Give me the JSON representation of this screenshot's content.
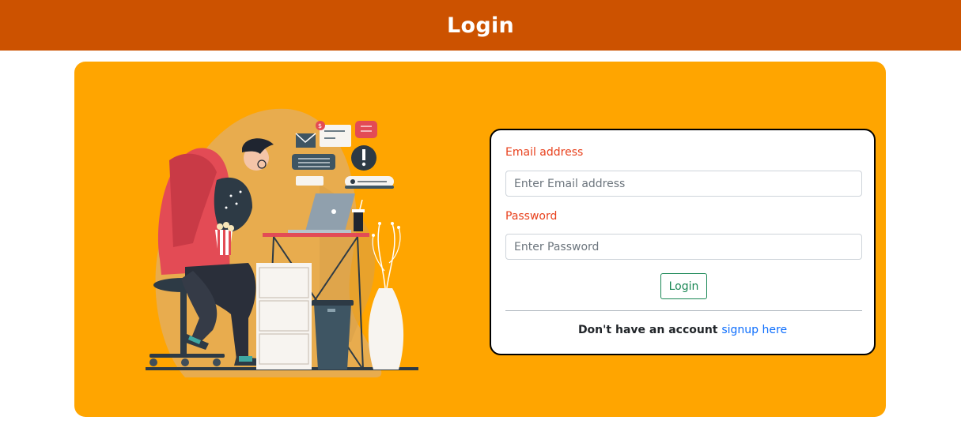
{
  "header": {
    "title": "Login"
  },
  "form": {
    "email_label": "Email address",
    "email_placeholder": "Enter Email address",
    "password_label": "Password",
    "password_placeholder": "Enter Password",
    "login_button": "Login",
    "signup_prompt": "Don't have an account",
    "signup_link": "signup here"
  },
  "colors": {
    "header_bg": "#cc5200",
    "panel_bg": "#ffa500",
    "label_color": "#e8401c",
    "button_color": "#198754",
    "link_color": "#0d6efd"
  },
  "illustration": {
    "icon": "person-at-desk-illustration"
  }
}
